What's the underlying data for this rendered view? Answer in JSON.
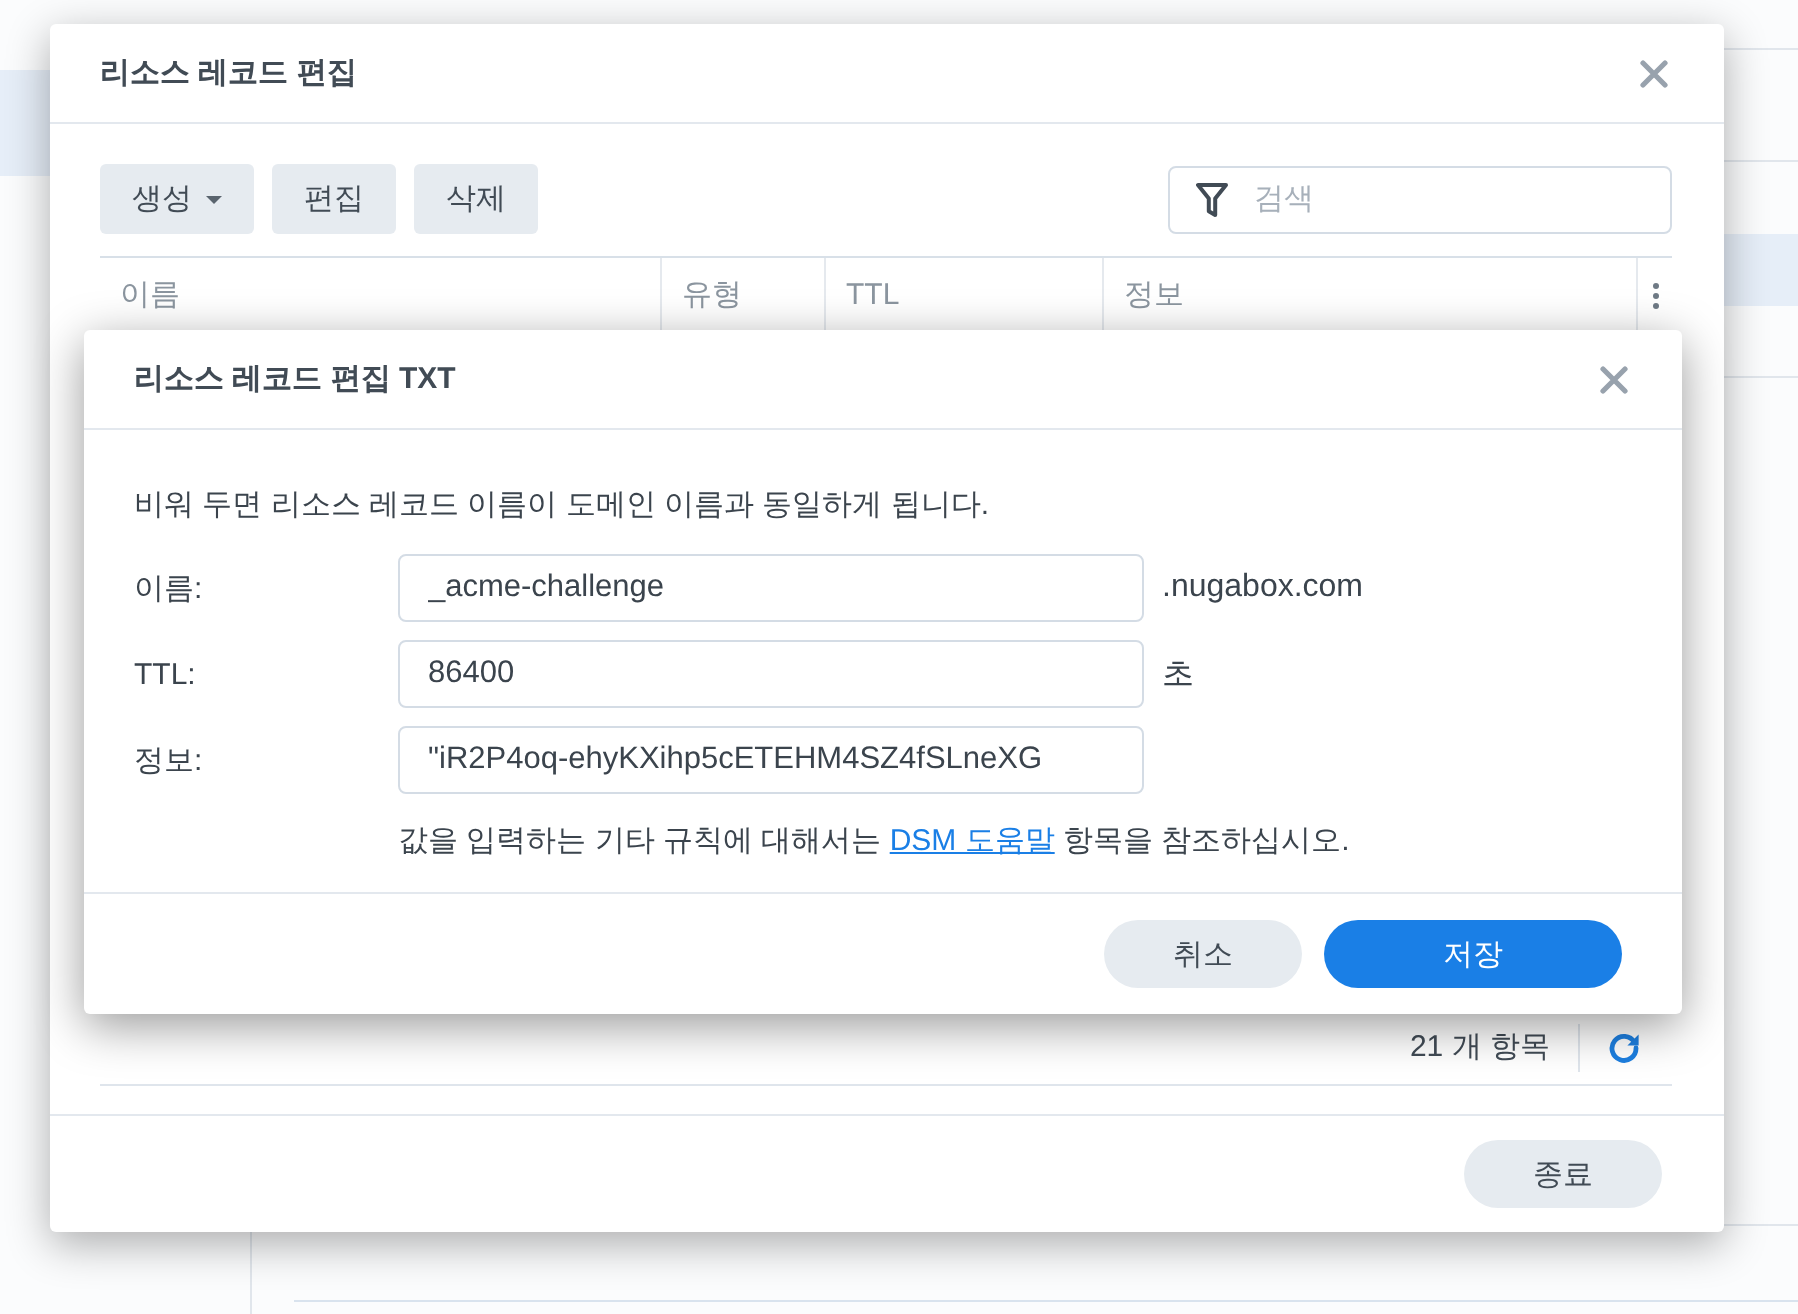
{
  "window": {
    "title": "리소스 레코드 편집"
  },
  "toolbar": {
    "buttons": [
      {
        "label": "생성",
        "kind": "dropdown"
      },
      {
        "label": "편집",
        "kind": "plain"
      },
      {
        "label": "삭제",
        "kind": "plain"
      }
    ],
    "search": {
      "placeholder": "검색"
    }
  },
  "table": {
    "columns": [
      "이름",
      "유형",
      "TTL",
      "정보"
    ]
  },
  "footer": {
    "count": "21 개 항목"
  },
  "buttons": [
    "종료"
  ],
  "dialog": {
    "title": "리소스 레코드 편집 TXT",
    "hint": "비워 두면 리소스 레코드 이름이 도메인 이름과 동일하게 됩니다.",
    "fields": [
      {
        "label": "이름:",
        "value": "_acme-challenge",
        "suffix": ".nugabox.com"
      },
      {
        "label": "TTL:",
        "value": "86400",
        "suffix": "초"
      },
      {
        "label": "정보:",
        "value": "\"iR2P4oq-ehyKXihp5cETEHM4SZ4fSLneXG"
      }
    ],
    "help": {
      "before": "값을 입력하는 기타 규칙에 대해서는",
      "link": "DSM 도움말",
      "after": "항목을 참조하십시오."
    },
    "buttons": [
      {
        "label": "취소",
        "kind": "secondary"
      },
      {
        "label": "저장",
        "kind": "primary"
      }
    ]
  }
}
